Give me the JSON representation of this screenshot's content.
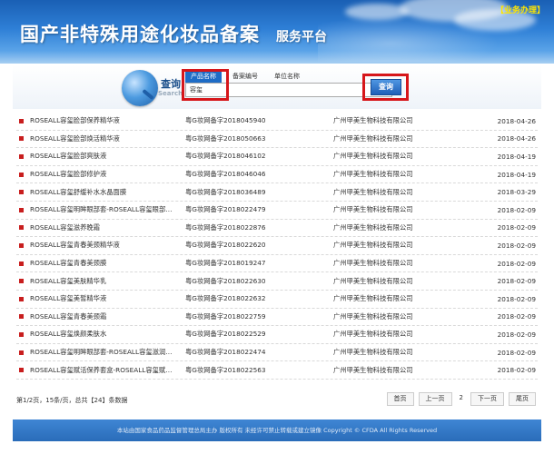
{
  "header": {
    "title": "国产非特殊用途化妆品备案",
    "subtitle": "服务平台",
    "biz_link": "【业务办理】"
  },
  "search": {
    "label": "查询",
    "label_en": "Search",
    "tabs": [
      {
        "label": "产品名称",
        "active": true
      },
      {
        "label": "备案编号",
        "active": false
      },
      {
        "label": "单位名称",
        "active": false
      }
    ],
    "query_value": "容玺",
    "button_label": "查询"
  },
  "results": [
    {
      "name": "ROSEALL容玺脸部保养精华液",
      "code": "粤G妆网备字2018045940",
      "company": "广州甲美生物科技有限公司",
      "date": "2018-04-26"
    },
    {
      "name": "ROSEALL容玺脸部焕活精华液",
      "code": "粤G妆网备字2018050663",
      "company": "广州甲美生物科技有限公司",
      "date": "2018-04-26"
    },
    {
      "name": "ROSEALL容玺脸部爽肤液",
      "code": "粤G妆网备字2018046102",
      "company": "广州甲美生物科技有限公司",
      "date": "2018-04-19"
    },
    {
      "name": "ROSEALL容玺脸部修护液",
      "code": "粤G妆网备字2018046046",
      "company": "广州甲美生物科技有限公司",
      "date": "2018-04-19"
    },
    {
      "name": "ROSEALL容玺舒缓补水水晶面膜",
      "code": "粤G妆网备字2018036489",
      "company": "广州甲美生物科技有限公司",
      "date": "2018-03-29"
    },
    {
      "name": "ROSEALL容玺明眸眼部套-ROSEALL容玺眼部…",
      "code": "粤G妆网备字2018022479",
      "company": "广州甲美生物科技有限公司",
      "date": "2018-02-09"
    },
    {
      "name": "ROSEALL容玺滋养晚霜",
      "code": "粤G妆网备字2018022876",
      "company": "广州甲美生物科技有限公司",
      "date": "2018-02-09"
    },
    {
      "name": "ROSEALL容玺青春美颈精华液",
      "code": "粤G妆网备字2018022620",
      "company": "广州甲美生物科技有限公司",
      "date": "2018-02-09"
    },
    {
      "name": "ROSEALL容玺青春美颈膜",
      "code": "粤G妆网备字2018019247",
      "company": "广州甲美生物科技有限公司",
      "date": "2018-02-09"
    },
    {
      "name": "ROSEALL容玺美肤精华乳",
      "code": "粤G妆网备字2018022630",
      "company": "广州甲美生物科技有限公司",
      "date": "2018-02-09"
    },
    {
      "name": "ROSEALL容玺美皙精华液",
      "code": "粤G妆网备字2018022632",
      "company": "广州甲美生物科技有限公司",
      "date": "2018-02-09"
    },
    {
      "name": "ROSEALL容玺青春美颈霜",
      "code": "粤G妆网备字2018022759",
      "company": "广州甲美生物科技有限公司",
      "date": "2018-02-09"
    },
    {
      "name": "ROSEALL容玺焕颜柔肤水",
      "code": "粤G妆网备字2018022529",
      "company": "广州甲美生物科技有限公司",
      "date": "2018-02-09"
    },
    {
      "name": "ROSEALL容玺明眸眼部套-ROSEALL容玺滋润…",
      "code": "粤G妆网备字2018022474",
      "company": "广州甲美生物科技有限公司",
      "date": "2018-02-09"
    },
    {
      "name": "ROSEALL容玺赋活保养套盒-ROSEALL容玺赋…",
      "code": "粤G妆网备字2018022563",
      "company": "广州甲美生物科技有限公司",
      "date": "2018-02-09"
    }
  ],
  "pagination": {
    "info": "第1/2页，15条/页，总共【24】条数据",
    "first": "首页",
    "prev": "上一页",
    "current_page": "2",
    "next": "下一页",
    "last": "尾页"
  },
  "footer": {
    "text": "本站由国家食品药品监督管理总局主办 版权所有 未经许可禁止转载或建立镜像 Copyright © CFDA All Rights Reserved"
  }
}
